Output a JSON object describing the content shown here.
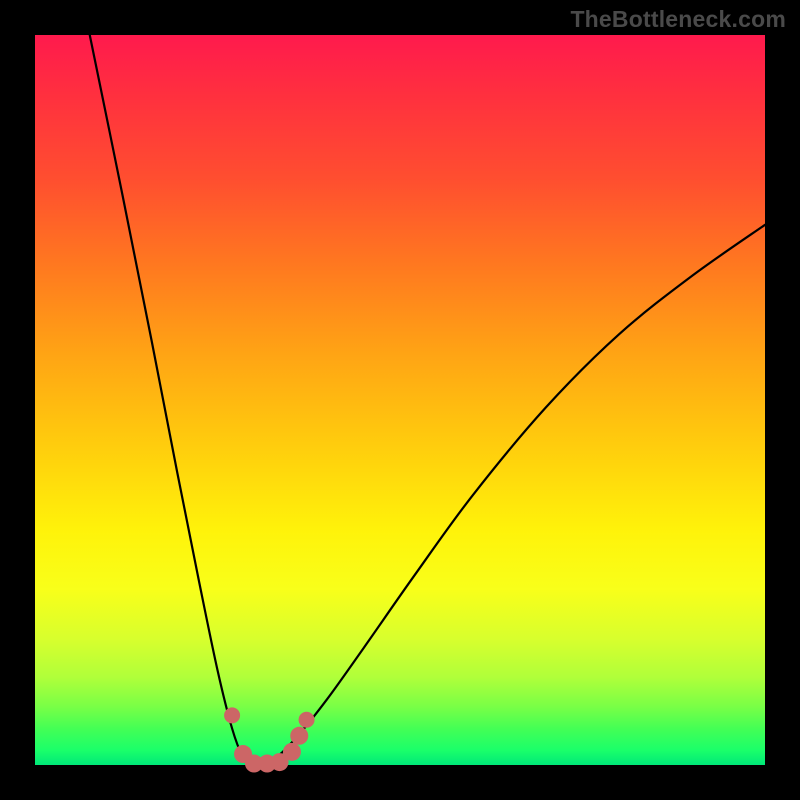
{
  "watermark": "TheBottleneck.com",
  "chart_data": {
    "type": "line",
    "title": "",
    "xlabel": "",
    "ylabel": "",
    "xlim": [
      0,
      1
    ],
    "ylim": [
      0,
      1
    ],
    "series": [
      {
        "name": "curve",
        "color": "#000000",
        "x": [
          0.075,
          0.12,
          0.16,
          0.195,
          0.225,
          0.25,
          0.27,
          0.285,
          0.295,
          0.305,
          0.33,
          0.36,
          0.4,
          0.45,
          0.52,
          0.6,
          0.7,
          0.8,
          0.9,
          1.0
        ],
        "y": [
          1.0,
          0.78,
          0.58,
          0.4,
          0.25,
          0.13,
          0.05,
          0.01,
          0.0,
          0.0,
          0.01,
          0.04,
          0.09,
          0.16,
          0.26,
          0.37,
          0.49,
          0.59,
          0.67,
          0.74
        ]
      },
      {
        "name": "markers",
        "color": "#cc6666",
        "x": [
          0.27,
          0.285,
          0.3,
          0.318,
          0.335,
          0.352,
          0.362,
          0.372
        ],
        "y": [
          0.068,
          0.015,
          0.002,
          0.002,
          0.004,
          0.018,
          0.04,
          0.062
        ]
      }
    ]
  },
  "style": {
    "frame_color": "#000000",
    "marker_color": "#cc6666",
    "curve_color": "#000000"
  }
}
